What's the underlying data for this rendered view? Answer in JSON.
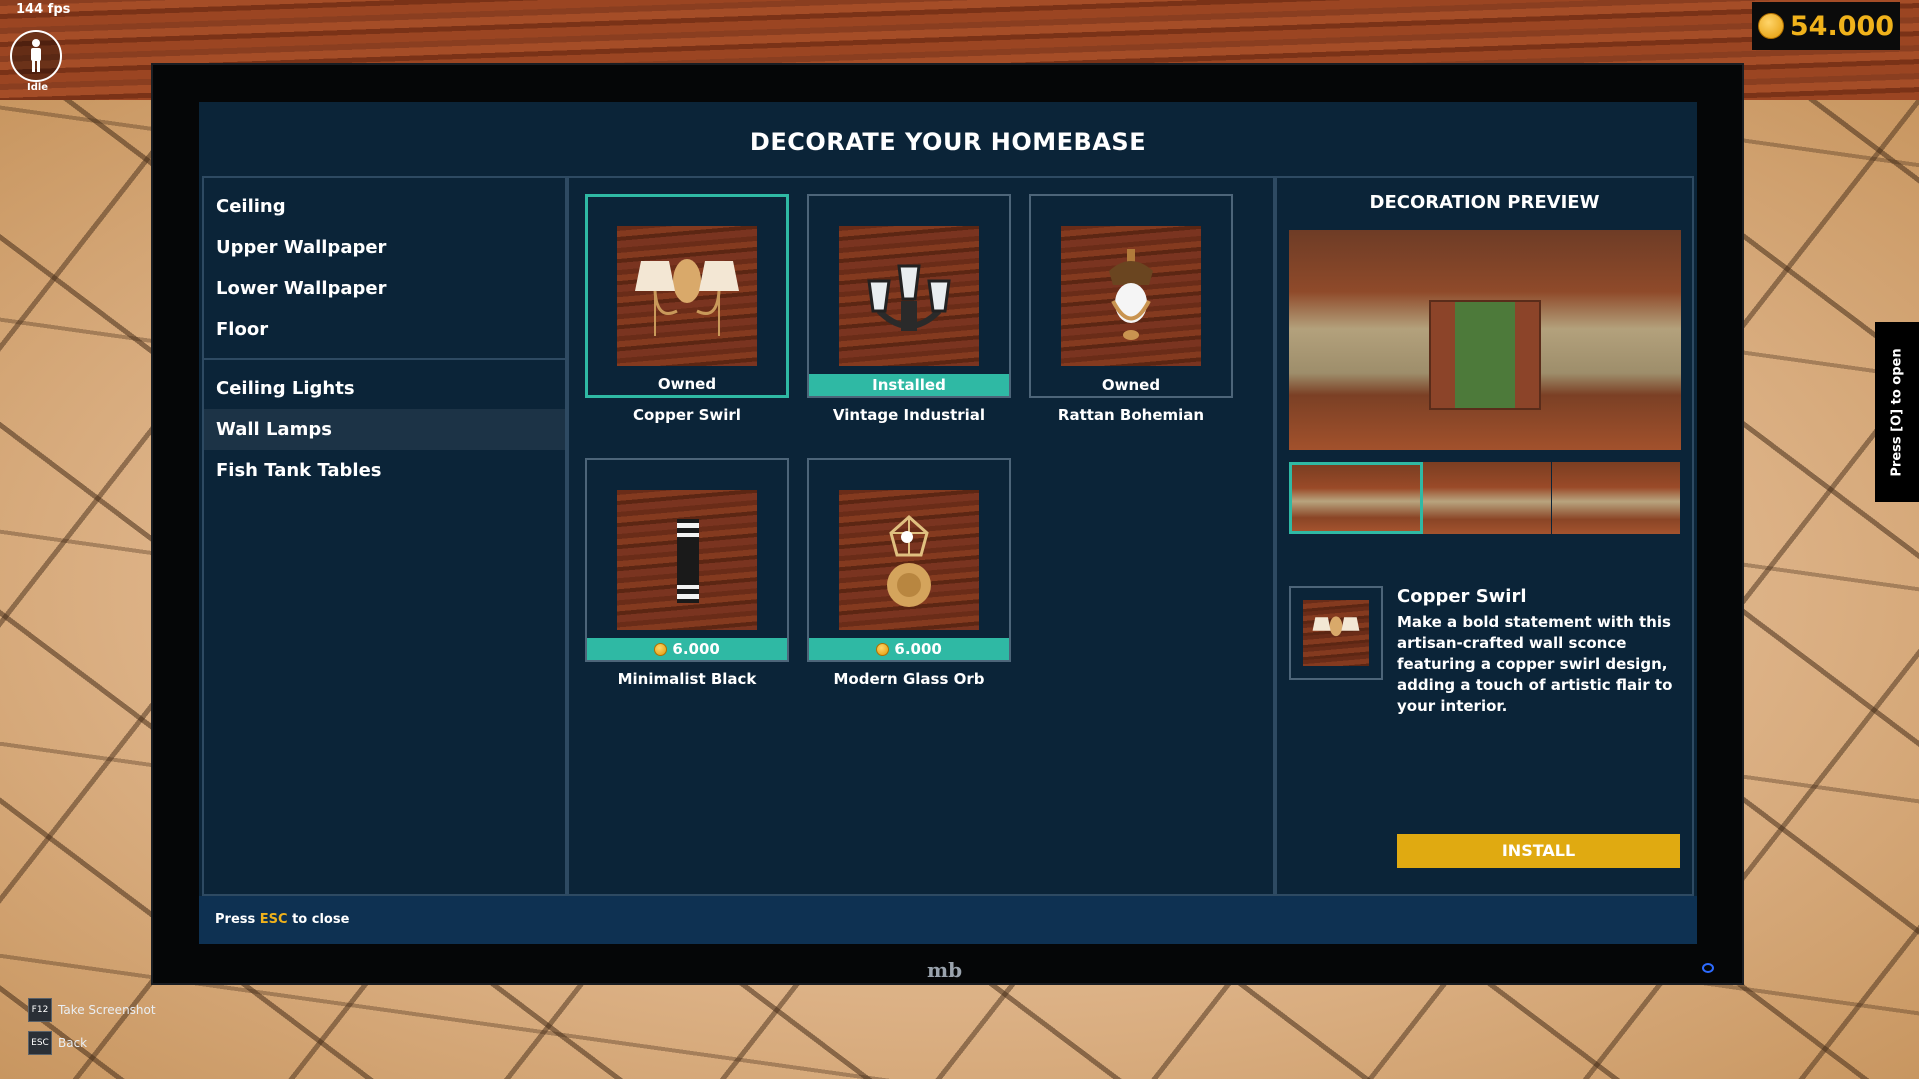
{
  "hud": {
    "fps": "144 fps",
    "status": "Idle",
    "coins": "54.000"
  },
  "window": {
    "title": "DECORATE YOUR HOMEBASE",
    "footer_prefix": "Press ",
    "footer_key": "ESC",
    "footer_suffix": " to close"
  },
  "categories": {
    "group1": [
      "Ceiling",
      "Upper Wallpaper",
      "Lower Wallpaper",
      "Floor"
    ],
    "group2": [
      "Ceiling Lights",
      "Wall Lamps",
      "Fish Tank Tables"
    ],
    "active": "Wall Lamps"
  },
  "items": [
    {
      "name": "Copper Swirl",
      "status": "Owned",
      "selected": true
    },
    {
      "name": "Vintage Industrial",
      "status": "Installed",
      "selected": false
    },
    {
      "name": "Rattan Bohemian",
      "status": "Owned",
      "selected": false
    },
    {
      "name": "Minimalist Black",
      "price": "6.000",
      "selected": false
    },
    {
      "name": "Modern Glass Orb",
      "price": "6.000",
      "selected": false
    }
  ],
  "preview": {
    "title": "DECORATION PREVIEW",
    "selected_name": "Copper Swirl",
    "description": "Make a bold statement with this artisan-crafted wall sconce featuring a copper swirl design, adding a touch of artistic flair to your interior.",
    "install_label": "INSTALL"
  },
  "side_tab": "Press [O] to open",
  "brand": "mb",
  "hints": [
    {
      "key": "F12",
      "label": "Take Screenshot"
    },
    {
      "key": "ESC",
      "label": "Back"
    }
  ],
  "colors": {
    "accent_teal": "#2fb9a4",
    "install_yellow": "#e0aa11",
    "coin_gold": "#f0b21b"
  }
}
